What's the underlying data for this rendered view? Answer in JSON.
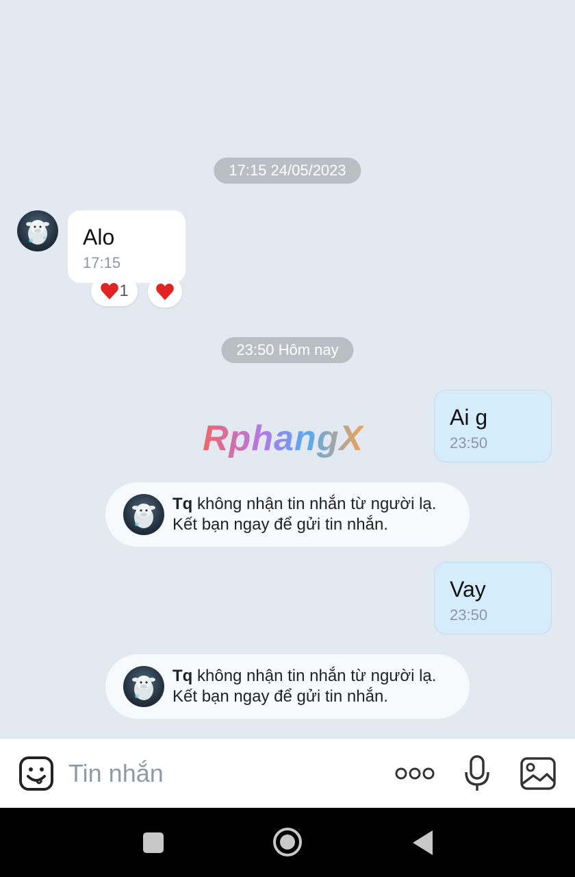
{
  "chat": {
    "date_pill_1": "17:15 24/05/2023",
    "date_pill_2": "23:50 Hôm nay",
    "messages": [
      {
        "direction": "in",
        "text": "Alo",
        "time": "17:15",
        "reaction_count": "1"
      },
      {
        "direction": "out",
        "text": "Ai g",
        "time": "23:50"
      },
      {
        "direction": "out",
        "text": "Vay",
        "time": "23:50"
      }
    ],
    "notices": [
      {
        "name": "Tq",
        "line1_rest": " không nhận tin nhắn từ người lạ.",
        "line2": "Kết bạn ngay để gửi tin nhắn."
      },
      {
        "name": "Tq",
        "line1_rest": " không nhận tin nhắn từ người lạ.",
        "line2": "Kết bạn ngay để gửi tin nhắn."
      }
    ],
    "watermark": "RphangX"
  },
  "input": {
    "placeholder": "Tin nhắn"
  },
  "icons": {
    "emoji": "emoji-icon",
    "more": "more-icon",
    "mic": "microphone-icon",
    "image": "image-icon",
    "nav_square": "recent-apps-icon",
    "nav_circle": "home-icon",
    "nav_back": "back-icon"
  },
  "colors": {
    "chat_background": "#e2e9f1",
    "outgoing_bubble": "#d5ecfc",
    "incoming_bubble": "#ffffff",
    "heart": "#e02424"
  }
}
